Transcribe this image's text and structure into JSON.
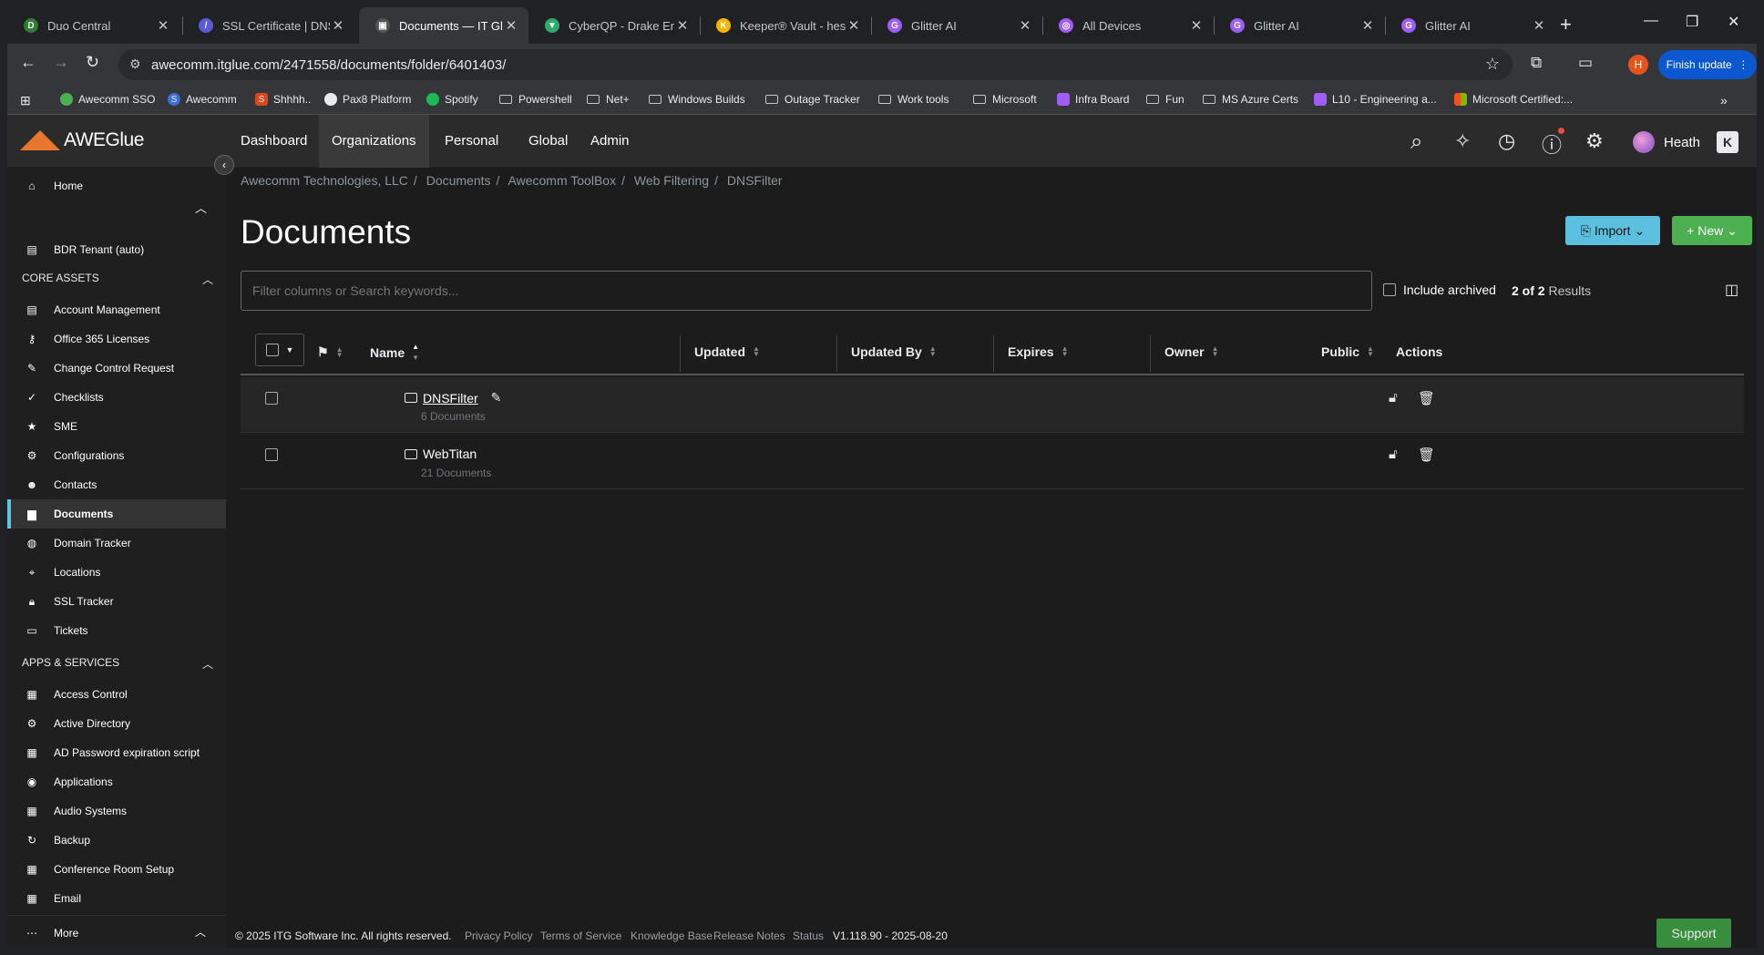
{
  "browser": {
    "tabs": [
      {
        "title": "Duo Central",
        "icon": "duo-icon",
        "color": "#2e7d32"
      },
      {
        "title": "SSL Certificate | DNSF",
        "icon": "ssl-icon",
        "color": "#5b5bd6"
      },
      {
        "title": "Documents — IT Glue",
        "icon": "itglue-icon",
        "color": "#555555"
      },
      {
        "title": "CyberQP - Drake Ente",
        "icon": "cyberqp-icon",
        "color": "#2eaa6a"
      },
      {
        "title": "Keeper® Vault - hescl",
        "icon": "keeper-icon",
        "color": "#f5b400"
      },
      {
        "title": "Glitter AI",
        "icon": "glitter-icon",
        "color": "#9c5cf5"
      },
      {
        "title": "All Devices",
        "icon": "devices-icon",
        "color": "#a15cf5"
      },
      {
        "title": "Glitter AI",
        "icon": "glitter-icon",
        "color": "#9c5cf5"
      },
      {
        "title": "Glitter AI",
        "icon": "glitter-icon",
        "color": "#9c5cf5"
      }
    ],
    "url": "awecomm.itglue.com/2471558/documents/folder/6401403/",
    "profile_initial": "H",
    "finish_update": "Finish update",
    "bookmarks": [
      {
        "label": "Awecomm SSO",
        "type": "site"
      },
      {
        "label": "Awecomm",
        "type": "site"
      },
      {
        "label": "Shhhh..",
        "type": "site"
      },
      {
        "label": "Pax8 Platform",
        "type": "site"
      },
      {
        "label": "Spotify",
        "type": "site"
      },
      {
        "label": "Powershell",
        "type": "folder"
      },
      {
        "label": "Net+",
        "type": "folder"
      },
      {
        "label": "Windows Builds",
        "type": "folder"
      },
      {
        "label": "Outage Tracker",
        "type": "folder"
      },
      {
        "label": "Work tools",
        "type": "folder"
      },
      {
        "label": "Microsoft",
        "type": "folder"
      },
      {
        "label": "Infra Board",
        "type": "site"
      },
      {
        "label": "Fun",
        "type": "folder"
      },
      {
        "label": "MS Azure Certs",
        "type": "folder"
      },
      {
        "label": "L10 - Engineering a...",
        "type": "site"
      },
      {
        "label": "Microsoft Certified:...",
        "type": "site"
      }
    ]
  },
  "app": {
    "logo_text": "AWEGlue",
    "nav": [
      "Dashboard",
      "Organizations",
      "Personal",
      "Global",
      "Admin"
    ],
    "active_nav": "Organizations",
    "user_name": "Heath",
    "kaseya_glyph": "K"
  },
  "sidebar": {
    "home": "Home",
    "bdr": "BDR Tenant (auto)",
    "core_assets_label": "CORE ASSETS",
    "core_assets": [
      {
        "label": "Account Management",
        "icon": "grid-icon"
      },
      {
        "label": "Office 365 Licenses",
        "icon": "key-icon"
      },
      {
        "label": "Change Control Request",
        "icon": "edit-icon"
      },
      {
        "label": "Checklists",
        "icon": "check-icon"
      },
      {
        "label": "SME",
        "icon": "star-icon"
      },
      {
        "label": "Configurations",
        "icon": "gear-icon"
      },
      {
        "label": "Contacts",
        "icon": "users-icon"
      },
      {
        "label": "Documents",
        "icon": "document-icon"
      },
      {
        "label": "Domain Tracker",
        "icon": "globe-icon"
      },
      {
        "label": "Locations",
        "icon": "pin-icon"
      },
      {
        "label": "SSL Tracker",
        "icon": "lock-icon"
      },
      {
        "label": "Tickets",
        "icon": "ticket-icon"
      }
    ],
    "active_item": "Documents",
    "apps_label": "APPS & SERVICES",
    "apps": [
      {
        "label": "Access Control",
        "icon": "grid-icon"
      },
      {
        "label": "Active Directory",
        "icon": "gear-icon"
      },
      {
        "label": "AD Password expiration script",
        "icon": "grid-icon"
      },
      {
        "label": "Applications",
        "icon": "play-icon"
      },
      {
        "label": "Audio Systems",
        "icon": "grid-icon"
      },
      {
        "label": "Backup",
        "icon": "refresh-icon"
      },
      {
        "label": "Conference Room Setup",
        "icon": "grid-icon"
      },
      {
        "label": "Email",
        "icon": "grid-icon"
      }
    ],
    "more": "More"
  },
  "main": {
    "breadcrumb": [
      "Awecomm Technologies, LLC",
      "Documents",
      "Awecomm ToolBox",
      "Web Filtering",
      "DNSFilter"
    ],
    "title": "Documents",
    "import_label": "Import",
    "new_label": "New",
    "search_placeholder": "Filter columns or Search keywords...",
    "include_archived": "Include archived",
    "results_count": "2 of 2",
    "results_label": "Results",
    "columns": [
      "Name",
      "Updated",
      "Updated By",
      "Expires",
      "Owner",
      "Public",
      "Actions"
    ],
    "rows": [
      {
        "name": "DNSFilter",
        "sub": "6 Documents",
        "linked": true
      },
      {
        "name": "WebTitan",
        "sub": "21 Documents",
        "linked": false
      }
    ]
  },
  "footer": {
    "copyright": "© 2025 ITG Software Inc. All rights reserved.",
    "links": [
      "Privacy Policy",
      "Terms of Service",
      "Knowledge Base",
      "Release Notes",
      "Status"
    ],
    "version": "V1.118.90 - 2025-08-20",
    "support": "Support"
  },
  "colors": {
    "accent": "#5ec4e4",
    "import_btn": "#5bc0de",
    "new_btn": "#4caf50",
    "logo": "#e8762c"
  }
}
